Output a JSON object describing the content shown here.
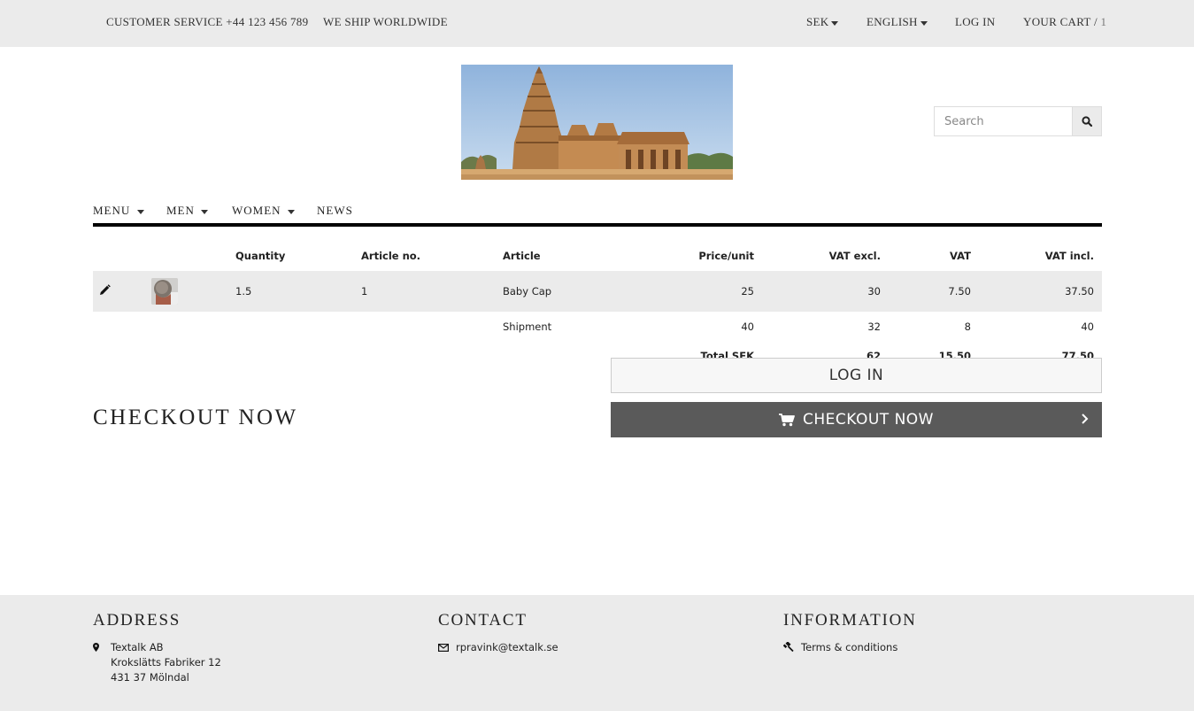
{
  "topbar": {
    "customer_service": "CUSTOMER SERVICE +44 123 456 789",
    "shipping": "WE SHIP WORLDWIDE",
    "currency": "SEK",
    "language": "ENGLISH",
    "login": "LOG IN",
    "cart_label": "YOUR CART /",
    "cart_count": "1"
  },
  "search": {
    "placeholder": "Search"
  },
  "nav": {
    "items": [
      "MENU",
      "MEN",
      "WOMEN",
      "NEWS"
    ]
  },
  "cart": {
    "headers": [
      "Quantity",
      "Article no.",
      "Article",
      "Price/unit",
      "VAT excl.",
      "VAT",
      "VAT incl."
    ],
    "items": [
      {
        "quantity": "1.5",
        "article_no": "1",
        "article": "Baby Cap",
        "price_unit": "25",
        "vat_excl": "30",
        "vat": "7.50",
        "vat_incl": "37.50"
      }
    ],
    "shipment": {
      "label": "Shipment",
      "price_unit": "40",
      "vat_excl": "32",
      "vat": "8",
      "vat_incl": "40"
    },
    "total": {
      "label": "Total SEK",
      "vat_excl": "62",
      "vat": "15.50",
      "vat_incl": "77.50"
    }
  },
  "actions": {
    "login_label": "LOG IN",
    "checkout_label": "CHECKOUT NOW",
    "checkout_title": "CHECKOUT NOW"
  },
  "footer": {
    "address": {
      "heading": "ADDRESS",
      "lines": [
        "Textalk AB",
        "Krokslätts Fabriker 12",
        "431 37 Mölndal"
      ]
    },
    "contact": {
      "heading": "CONTACT",
      "email": "rpravink@textalk.se"
    },
    "information": {
      "heading": "INFORMATION",
      "terms": "Terms & conditions"
    }
  },
  "icons": {
    "search": "search-icon",
    "edit": "pencil-icon",
    "cart": "cart-icon",
    "chevron": "chevron-right-icon",
    "map": "map-marker-icon",
    "email": "envelope-icon",
    "terms": "gavel-icon"
  },
  "colors": {
    "topbar_bg": "#ebebeb",
    "checkout_bg": "#5a5a5a",
    "footer_bg": "#ebebeb"
  }
}
